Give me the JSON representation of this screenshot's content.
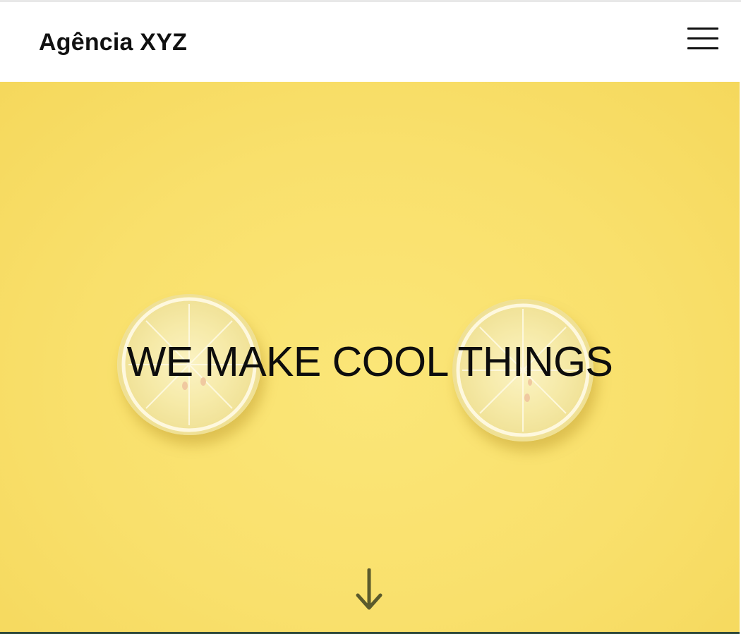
{
  "header": {
    "brand": "Agência XYZ",
    "menu_icon": "hamburger-menu-icon"
  },
  "hero": {
    "headline": "WE MAKE COOL THINGS",
    "background_image": "lemon-slices-on-yellow",
    "scroll_icon": "arrow-down-icon"
  },
  "colors": {
    "hero_background": "#f9e06c",
    "text": "#0d0d0d",
    "header_background": "#ffffff",
    "arrow": "#5b5a2c",
    "bottom_strip": "#2f4a3a"
  }
}
